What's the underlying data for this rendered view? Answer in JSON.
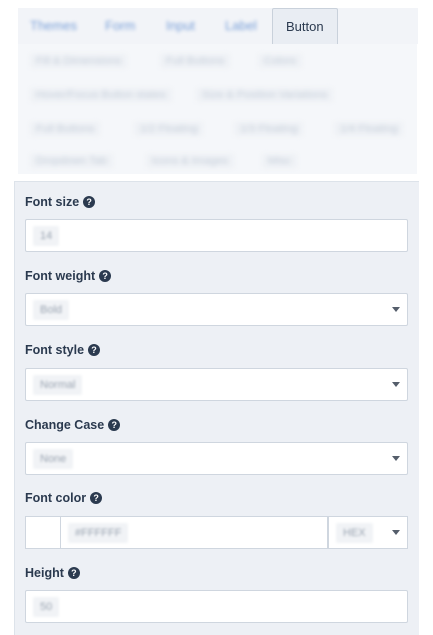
{
  "tabs": [
    {
      "label": "Themes",
      "active": false
    },
    {
      "label": "Form",
      "active": false
    },
    {
      "label": "Input",
      "active": false
    },
    {
      "label": "Label",
      "active": false
    },
    {
      "label": "Button",
      "active": true
    }
  ],
  "subnav": [
    "Fill & Dimensions",
    "Full Buttons",
    "Colors",
    "Hover/Focus Button states",
    "Size & Position Variations",
    "Full Buttons",
    "1/2 Floating",
    "1/3 Floating",
    "1/4 Floating",
    "Dropdown Tab",
    "Icons & Images",
    "Misc"
  ],
  "fields": {
    "font_size": {
      "label": "Font size",
      "value": "14"
    },
    "font_weight": {
      "label": "Font weight",
      "value": "Bold"
    },
    "font_style": {
      "label": "Font style",
      "value": "Normal"
    },
    "change_case": {
      "label": "Change Case",
      "value": "None"
    },
    "font_color": {
      "label": "Font color",
      "value": "#FFFFFF",
      "mode": "HEX",
      "swatch": "#ffffff"
    },
    "height": {
      "label": "Height",
      "value": "50"
    }
  },
  "help_glyph": "?"
}
